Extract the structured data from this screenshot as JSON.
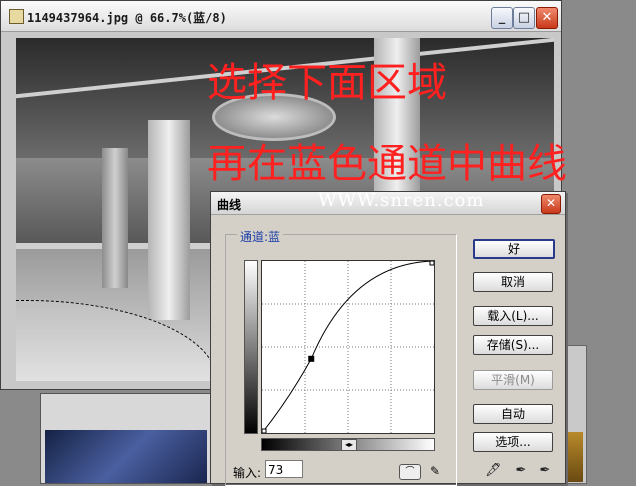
{
  "document_window": {
    "title": "1149437964.jpg @ 66.7%(蓝/8)",
    "buttons": {
      "minimize": "_",
      "maximize": "□",
      "close": "✕"
    }
  },
  "overlay": {
    "line1": "选择下面区域",
    "line2": "再在蓝色通道中曲线",
    "watermark": "WWW.snren.com",
    "color": "#ff2020"
  },
  "dialog": {
    "title": "曲线",
    "close": "✕",
    "channel_label": "通道:蓝",
    "input_label": "输入:",
    "input_value": "73",
    "buttons": {
      "ok": "好",
      "cancel": "取消",
      "load": "载入(L)...",
      "save": "存储(S)...",
      "smooth": "平滑(M)",
      "auto": "自动",
      "options": "选项..."
    },
    "curve_control_point": {
      "input": 73,
      "output": 110
    },
    "icons": {
      "curve_mode": "curve-mode-icon",
      "pencil": "pencil-icon",
      "black_eyedropper": "black-eyedropper-icon",
      "gray_eyedropper": "gray-eyedropper-icon",
      "white_eyedropper": "white-eyedropper-icon"
    }
  }
}
